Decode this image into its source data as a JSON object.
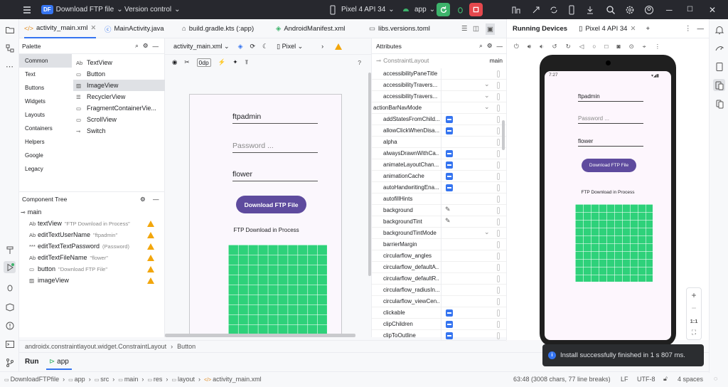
{
  "titlebar": {
    "project_badge": "DF",
    "project_name": "Download FTP file",
    "vcs_label": "Version control",
    "device": "Pixel 4 API 34",
    "run_config": "app"
  },
  "editor_tabs": [
    {
      "label": "activity_main.xml"
    },
    {
      "label": "MainActivity.java"
    },
    {
      "label": "build.gradle.kts (:app)"
    },
    {
      "label": "AndroidManifest.xml"
    },
    {
      "label": "libs.versions.toml"
    }
  ],
  "palette": {
    "title": "Palette",
    "categories": [
      "Common",
      "Text",
      "Buttons",
      "Widgets",
      "Layouts",
      "Containers",
      "Helpers",
      "Google",
      "Legacy"
    ],
    "items": [
      {
        "tag": "Ab",
        "label": "TextView"
      },
      {
        "tag": "",
        "label": "Button"
      },
      {
        "tag": "",
        "label": "ImageView"
      },
      {
        "tag": "",
        "label": "RecyclerView"
      },
      {
        "tag": "",
        "label": "FragmentContainerVie..."
      },
      {
        "tag": "",
        "label": "ScrollView"
      },
      {
        "tag": "",
        "label": "Switch"
      }
    ]
  },
  "component_tree": {
    "title": "Component Tree",
    "root": "main",
    "rows": [
      {
        "tag": "Ab",
        "label": "textView",
        "hint": "\"FTP Download in Process\""
      },
      {
        "tag": "Ab",
        "label": "editTextUserName",
        "hint": "\"ftpadmin\""
      },
      {
        "tag": "",
        "label": "editTextTextPassword",
        "hint": "(Password)"
      },
      {
        "tag": "Ab",
        "label": "editTextFileName",
        "hint": "\"flower\""
      },
      {
        "tag": "",
        "label": "button",
        "hint": "\"Download FTP File\""
      },
      {
        "tag": "",
        "label": "imageView",
        "hint": ""
      }
    ]
  },
  "design": {
    "file": "activity_main.xml",
    "device": "Pixel",
    "margin": "0dp",
    "help": "?"
  },
  "app_ui": {
    "username": "ftpadmin",
    "password_hint": "Password ...",
    "filename": "flower",
    "button": "Download FTP File",
    "status": "FTP Download in Process"
  },
  "attributes": {
    "title": "Attributes",
    "layout": "ConstraintLayout",
    "id": "main",
    "rows": [
      {
        "name": "accessibilityPaneTitle",
        "kind": "none"
      },
      {
        "name": "accessibilityTravers...",
        "kind": "dropdown"
      },
      {
        "name": "accessibilityTravers...",
        "kind": "dropdown"
      },
      {
        "name": "actionBarNavMode",
        "kind": "dropdown"
      },
      {
        "name": "addStatesFromChild...",
        "kind": "checkbox"
      },
      {
        "name": "allowClickWhenDisa...",
        "kind": "checkbox"
      },
      {
        "name": "alpha",
        "kind": "none"
      },
      {
        "name": "alwaysDrawnWithCa...",
        "kind": "checkbox"
      },
      {
        "name": "animateLayoutChan...",
        "kind": "checkbox"
      },
      {
        "name": "animationCache",
        "kind": "checkbox"
      },
      {
        "name": "autoHandwritingEna...",
        "kind": "checkbox"
      },
      {
        "name": "autofillHints",
        "kind": "none"
      },
      {
        "name": "background",
        "kind": "picker"
      },
      {
        "name": "backgroundTint",
        "kind": "picker"
      },
      {
        "name": "backgroundTintMode",
        "kind": "dropdown"
      },
      {
        "name": "barrierMargin",
        "kind": "none"
      },
      {
        "name": "circularflow_angles",
        "kind": "none"
      },
      {
        "name": "circularflow_defaultA...",
        "kind": "none"
      },
      {
        "name": "circularflow_defaultR...",
        "kind": "none"
      },
      {
        "name": "circularflow_radiusIn...",
        "kind": "none"
      },
      {
        "name": "circularflow_viewCen...",
        "kind": "none"
      },
      {
        "name": "clickable",
        "kind": "checkbox"
      },
      {
        "name": "clipChildren",
        "kind": "checkbox"
      },
      {
        "name": "clipToOutline",
        "kind": "checkbox"
      }
    ]
  },
  "status_bar": {
    "breadcrumb_1": "androidx.constraintlayout.widget.ConstraintLayout",
    "breadcrumb_2": "Button"
  },
  "run_panel": {
    "tab_run": "Run",
    "tab_app": "app"
  },
  "bottom": {
    "path": [
      "DownloadFTPfile",
      "app",
      "src",
      "main",
      "res",
      "layout",
      "activity_main.xml"
    ],
    "position": "63:48 (3008 chars, 77 line breaks)",
    "line_sep": "LF",
    "encoding": "UTF-8",
    "indent": "4 spaces"
  },
  "running_devices": {
    "title": "Running Devices",
    "device_tab": "Pixel 4 API 34",
    "clock": "7:27",
    "zoom_label": "1:1"
  },
  "toast": "Install successfully finished in 1 s 807 ms.",
  "colors": {
    "accent": "#3574f0",
    "button": "#5e4b9e",
    "grid": "#2ed17a",
    "run": "#3db36b",
    "stop": "#e5484d"
  }
}
